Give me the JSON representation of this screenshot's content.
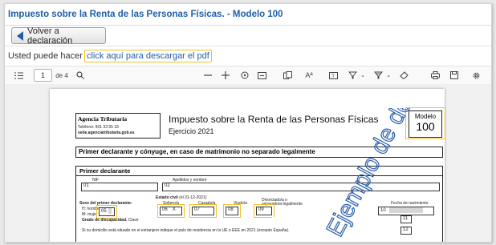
{
  "page": {
    "title": "Impuesto sobre la Renta de las Personas Físicas. - Modelo 100",
    "back_button": "Volver a declaración",
    "download_prefix": "Usted puede hacer",
    "download_link": "click aquí para descargar el pdf"
  },
  "toolbar": {
    "page_number": "1",
    "page_total": "de 4",
    "icons": [
      "sidebar-toggle-icon",
      "search-icon",
      "zoom-out-icon",
      "zoom-in-icon",
      "cursor-icon",
      "fit-width-icon",
      "page-icon",
      "read-aloud-icon",
      "text-icon",
      "highlight-icon",
      "chevron-down-icon",
      "draw-icon",
      "chevron-down-icon",
      "erase-icon",
      "print-icon",
      "save-icon",
      "settings-icon"
    ]
  },
  "document": {
    "agency": "Agencia Tributaria",
    "phone": "Teléfono: 901 33 55 33",
    "site": "sede.agenciatributaria.gob.es",
    "heading": "Impuesto sobre la Renta de las Personas Físicas",
    "exercise": "Ejercicio 2021",
    "modelo_label": "Modelo",
    "modelo_number": "100",
    "section_main": "Primer declarante y cónyuge, en caso de matrimonio no separado legalmente",
    "section_first": "Primer declarante",
    "nif_label": "NIF",
    "name_label": "Apellidos y nombre",
    "nif_code": "01",
    "name_code": "02",
    "civil_status_label": "Estado civil",
    "civil_status_date": "(el 31-12-2021)",
    "single": "Soltero/a",
    "married": "Casado/a",
    "widowed": "Viudo/a",
    "divorced": "Divorciado/a o separado/a legalmente",
    "birth_date_label": "Fecha de nacimiento",
    "sex_label": "Sexo del primer declarante:",
    "sex_h": "H: hombre",
    "sex_m": "M: mujer",
    "sex_code": "05",
    "single_code": "06",
    "single_mark": "X",
    "married_code": "07",
    "widowed_code": "08",
    "divorced_code": "09",
    "box_10": "10",
    "box_11": "11",
    "disability_label": "Grado de discapacidad.",
    "disability_key": "Clave",
    "abroad_text": "Si su domicilio está situado en el extranjero indique el país de residencia en la UE o EEE en 2021 (excepto España).",
    "box_12": "12",
    "watermark": "Ejemplo de declaración"
  }
}
